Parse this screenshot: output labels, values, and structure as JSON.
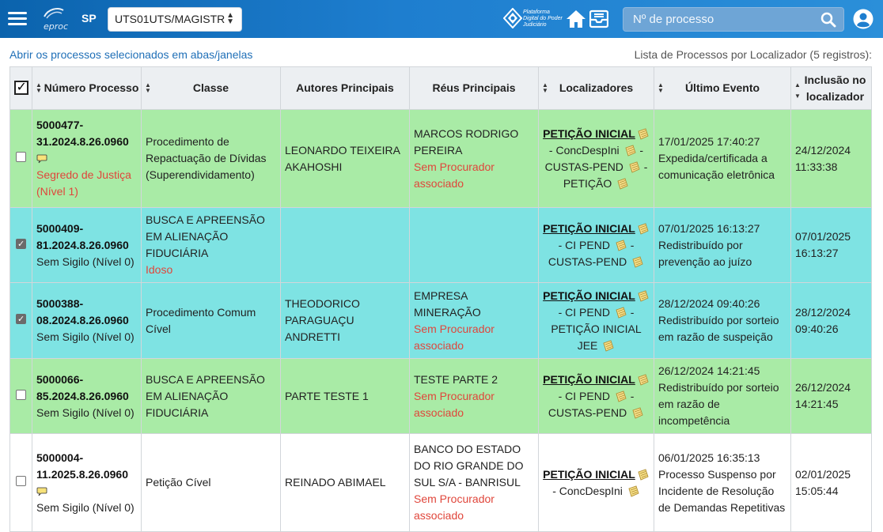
{
  "header": {
    "logo_text": "eproc",
    "uf": "SP",
    "unit_select": "UTS01UTS/MAGISTR",
    "pdpj_text": "Plataforma Digital do Poder Judiciário",
    "search_placeholder": "Nº de processo"
  },
  "subheader": {
    "open_link": "Abrir os processos selecionados em abas/janelas",
    "list_info": "Lista de Processos por Localizador (5 registros):"
  },
  "table": {
    "columns": {
      "numero": "Número Processo",
      "classe": "Classe",
      "autores": "Autores Principais",
      "reus": "Réus Principais",
      "localizadores": "Localizadores",
      "ultimo_evento": "Último Evento",
      "inclusao_1": "Inclusão no",
      "inclusao_2": "localizador"
    },
    "rows": [
      {
        "color": "green",
        "checked": false,
        "num_1": "5000477-",
        "num_2": "31.2024.8.26.0960",
        "has_note": true,
        "sigilo_1": "Segredo de Justiça",
        "sigilo_2": "(Nível 1)",
        "sigilo_red": true,
        "classe": "Procedimento de Repactuação de Dívidas (Superendividamento)",
        "classe_extra": "",
        "autor": "LEONARDO TEIXEIRA AKAHOSHI",
        "reu": "MARCOS RODRIGO PEREIRA",
        "reu_extra": "Sem Procurador associado",
        "loc_main": "PETIÇÃO INICIAL",
        "loc_rest": [
          "- ConcDespIni",
          "- CUSTAS-PEND",
          "- PETIÇÃO"
        ],
        "evento_data": "17/01/2025 17:40:27",
        "evento_desc": "Expedida/certificada a comunicação eletrônica",
        "inclusao_1": "24/12/2024",
        "inclusao_2": "11:33:38"
      },
      {
        "color": "cyan",
        "checked": true,
        "num_1": "5000409-",
        "num_2": "81.2024.8.26.0960",
        "has_note": false,
        "sigilo_1": "Sem Sigilo (Nível 0)",
        "sigilo_2": "",
        "sigilo_red": false,
        "classe": "BUSCA E APREENSÃO EM ALIENAÇÃO FIDUCIÁRIA",
        "classe_extra": "Idoso",
        "autor": "",
        "reu": "",
        "reu_extra": "",
        "loc_main": "PETIÇÃO INICIAL",
        "loc_rest": [
          "- CI PEND",
          "- CUSTAS-PEND"
        ],
        "evento_data": "07/01/2025 16:13:27",
        "evento_desc": "Redistribuído por prevenção ao juízo",
        "inclusao_1": "07/01/2025",
        "inclusao_2": "16:13:27"
      },
      {
        "color": "cyan",
        "checked": true,
        "num_1": "5000388-",
        "num_2": "08.2024.8.26.0960",
        "has_note": false,
        "sigilo_1": "Sem Sigilo (Nível 0)",
        "sigilo_2": "",
        "sigilo_red": false,
        "classe": "Procedimento Comum Cível",
        "classe_extra": "",
        "autor": "THEODORICO PARAGUAÇU ANDRETTI",
        "reu": "EMPRESA MINERAÇÃO",
        "reu_extra": "Sem Procurador associado",
        "loc_main": "PETIÇÃO INICIAL",
        "loc_rest": [
          "- CI PEND",
          "- PETIÇÃO INICIAL JEE"
        ],
        "evento_data": "28/12/2024 09:40:26",
        "evento_desc": "Redistribuído por sorteio em razão de suspeição",
        "inclusao_1": "28/12/2024",
        "inclusao_2": "09:40:26"
      },
      {
        "color": "green",
        "checked": false,
        "num_1": "5000066-",
        "num_2": "85.2024.8.26.0960",
        "has_note": false,
        "sigilo_1": "Sem Sigilo (Nível 0)",
        "sigilo_2": "",
        "sigilo_red": false,
        "classe": "BUSCA E APREENSÃO EM ALIENAÇÃO FIDUCIÁRIA",
        "classe_extra": "",
        "autor": "PARTE TESTE 1",
        "reu": "TESTE PARTE 2",
        "reu_extra": "Sem Procurador associado",
        "loc_main": "PETIÇÃO INICIAL",
        "loc_rest": [
          "- CI PEND",
          "- CUSTAS-PEND"
        ],
        "evento_data": "26/12/2024 14:21:45",
        "evento_desc": "Redistribuído por sorteio em razão de incompetência",
        "inclusao_1": "26/12/2024",
        "inclusao_2": "14:21:45"
      },
      {
        "color": "white",
        "checked": false,
        "num_1": "5000004-",
        "num_2": "11.2025.8.26.0960",
        "has_note": true,
        "sigilo_1": "Sem Sigilo (Nível 0)",
        "sigilo_2": "",
        "sigilo_red": false,
        "classe": "Petição Cível",
        "classe_extra": "",
        "autor": "REINADO ABIMAEL",
        "reu": "BANCO DO ESTADO DO RIO GRANDE DO SUL S/A - BANRISUL",
        "reu_extra": "Sem Procurador associado",
        "loc_main": "PETIÇÃO INICIAL",
        "loc_rest": [
          "- ConcDespIni"
        ],
        "evento_data": "06/01/2025 16:35:13",
        "evento_desc": "Processo Suspenso por Incidente de Resolução de Demandas Repetitivas",
        "inclusao_1": "02/01/2025",
        "inclusao_2": "15:05:44"
      }
    ]
  },
  "icons": {
    "menu": "hamburger-icon",
    "home": "home-icon",
    "tray": "inbox-icon",
    "search": "search-icon",
    "user": "user-icon",
    "note": "speech-bubble-icon",
    "pad": "notepad-icon"
  },
  "colors": {
    "topbar": "#0b63ad",
    "row_green": "#a9eba6",
    "row_cyan": "#7ee3e3",
    "link": "#1f6fb7",
    "red_text": "#e0463b"
  }
}
